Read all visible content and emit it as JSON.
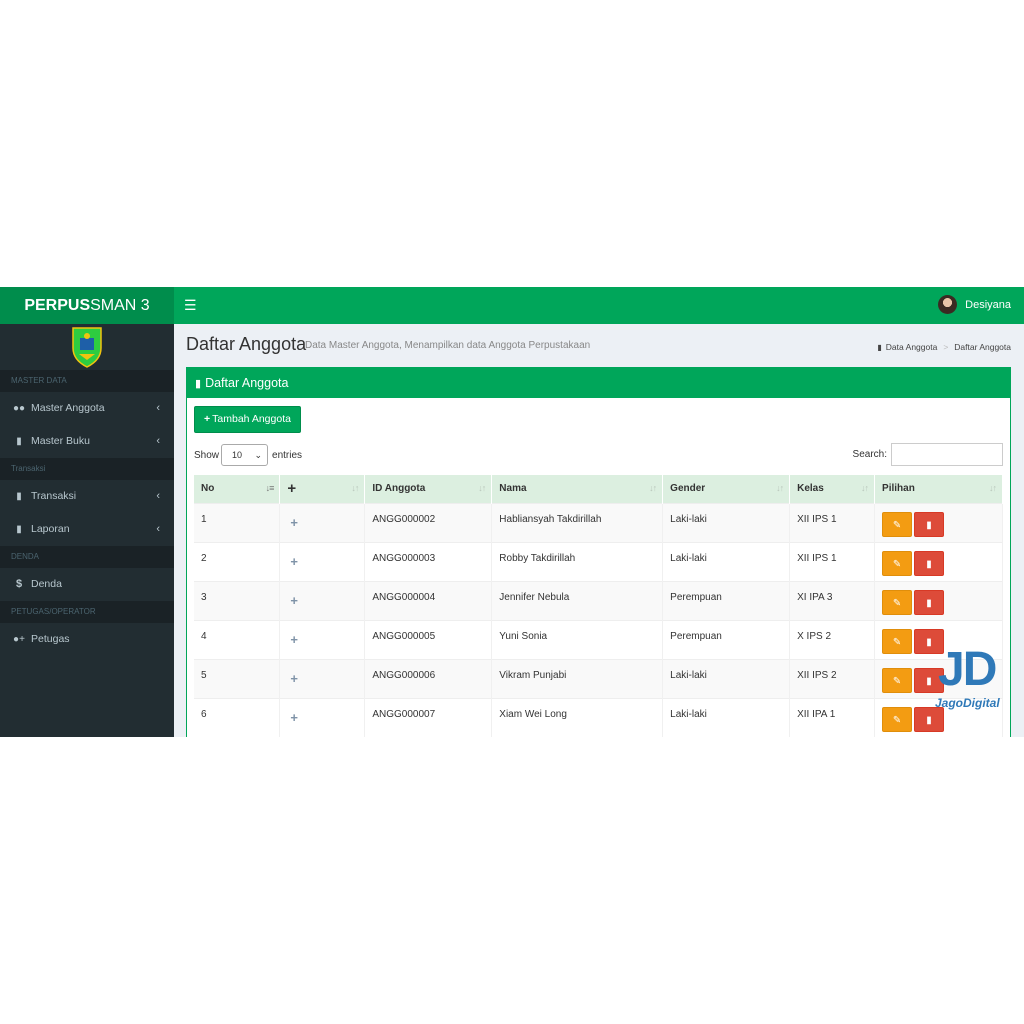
{
  "app": {
    "brand_bold": "PERPUS",
    "brand_rest": "SMAN 3",
    "menu_icon": "hamburger-icon",
    "user_name": "Desiyana"
  },
  "sidebar": {
    "sections": [
      {
        "header": "MASTER DATA",
        "items": [
          {
            "label": "Master Anggota",
            "icon": "users-icon",
            "has_submenu": true
          },
          {
            "label": "Master Buku",
            "icon": "book-icon",
            "has_submenu": true
          }
        ]
      },
      {
        "header": "Transaksi",
        "items": [
          {
            "label": "Transaksi",
            "icon": "book-icon",
            "has_submenu": true
          },
          {
            "label": "Laporan",
            "icon": "book-icon",
            "has_submenu": true
          }
        ]
      },
      {
        "header": "DENDA",
        "items": [
          {
            "label": "Denda",
            "icon": "dollar-icon",
            "has_submenu": false
          }
        ]
      },
      {
        "header": "PETUGAS/OPERATOR",
        "items": [
          {
            "label": "Petugas",
            "icon": "user-plus-icon",
            "has_submenu": false
          }
        ]
      }
    ]
  },
  "page": {
    "title": "Daftar Anggota",
    "subtitle": "Data Master Anggota, Menampilkan data Anggota Perpustakaan",
    "breadcrumb": [
      "Data Anggota",
      "Daftar Anggota"
    ]
  },
  "box": {
    "title": "Daftar Anggota",
    "add_button": "Tambah Anggota",
    "show_label": "Show",
    "entries_value": "10",
    "entries_label": "entries",
    "search_label": "Search:",
    "search_value": ""
  },
  "table": {
    "columns": [
      "No",
      "+",
      "ID Anggota",
      "Nama",
      "Gender",
      "Kelas",
      "Pilihan"
    ],
    "rows": [
      {
        "no": "1",
        "id": "ANGG000002",
        "nama": "Habliansyah Takdirillah",
        "gender": "Laki-laki",
        "kelas": "XII IPS 1"
      },
      {
        "no": "2",
        "id": "ANGG000003",
        "nama": "Robby Takdirillah",
        "gender": "Laki-laki",
        "kelas": "XII IPS 1"
      },
      {
        "no": "3",
        "id": "ANGG000004",
        "nama": "Jennifer Nebula",
        "gender": "Perempuan",
        "kelas": "XI IPA 3"
      },
      {
        "no": "4",
        "id": "ANGG000005",
        "nama": "Yuni Sonia",
        "gender": "Perempuan",
        "kelas": "X IPS 2"
      },
      {
        "no": "5",
        "id": "ANGG000006",
        "nama": "Vikram Punjabi",
        "gender": "Laki-laki",
        "kelas": "XII IPS 2"
      },
      {
        "no": "6",
        "id": "ANGG000007",
        "nama": "Xiam Wei Long",
        "gender": "Laki-laki",
        "kelas": "XII IPA 1"
      }
    ]
  },
  "watermark": {
    "mark": "JD",
    "text": "JagoDigital"
  },
  "colors": {
    "primary": "#00a65a",
    "primary_dark": "#008d4c",
    "sidebar": "#222d32",
    "edit": "#f39c12",
    "delete": "#dd4b39"
  }
}
